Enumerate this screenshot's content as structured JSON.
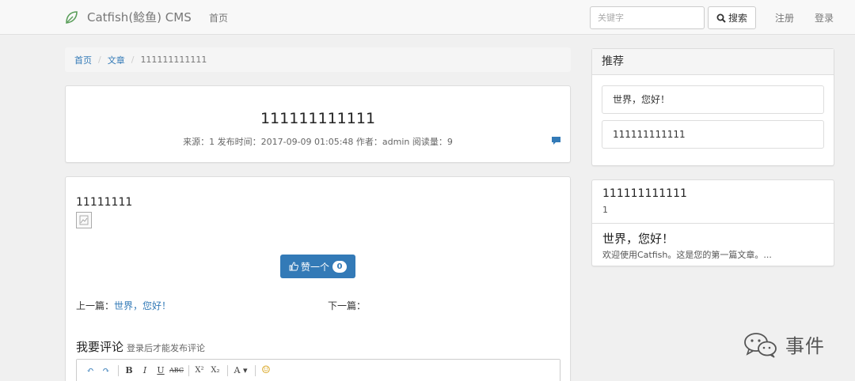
{
  "navbar": {
    "brand": "Catfish(鲶鱼) CMS",
    "home": "首页",
    "search_placeholder": "关键字",
    "search_button": "搜索",
    "register": "注册",
    "login": "登录"
  },
  "breadcrumb": {
    "home": "首页",
    "section": "文章",
    "current": "111111111111"
  },
  "article": {
    "title": "111111111111",
    "meta": "来源：1 发布时间：2017-09-09 01:05:48 作者：admin 阅读量：9",
    "body_text": "11111111",
    "like_label": "赞一个",
    "like_count": "0",
    "prev_label": "上一篇：",
    "prev_title": "世界，您好！",
    "next_label": "下一篇：",
    "comment_title": "我要评论",
    "comment_hint": "登录后才能发布评论"
  },
  "editor": {
    "tools": [
      "↶",
      "↷",
      "B",
      "I",
      "U",
      "ABC",
      "X²",
      "X₂",
      "A ▾",
      "☺"
    ]
  },
  "sidebar": {
    "recommend_title": "推荐",
    "recommend_items": [
      "世界，您好！",
      "111111111111"
    ],
    "list": [
      {
        "title": "111111111111",
        "summary": "1"
      },
      {
        "title": "世界，您好！",
        "summary": "欢迎使用Catfish。这是您的第一篇文章。..."
      }
    ]
  },
  "watermark": {
    "text": "事件"
  },
  "colors": {
    "link": "#337ab7",
    "navbar_bg": "#f8f8f8",
    "page_bg": "#f0f0f0"
  }
}
